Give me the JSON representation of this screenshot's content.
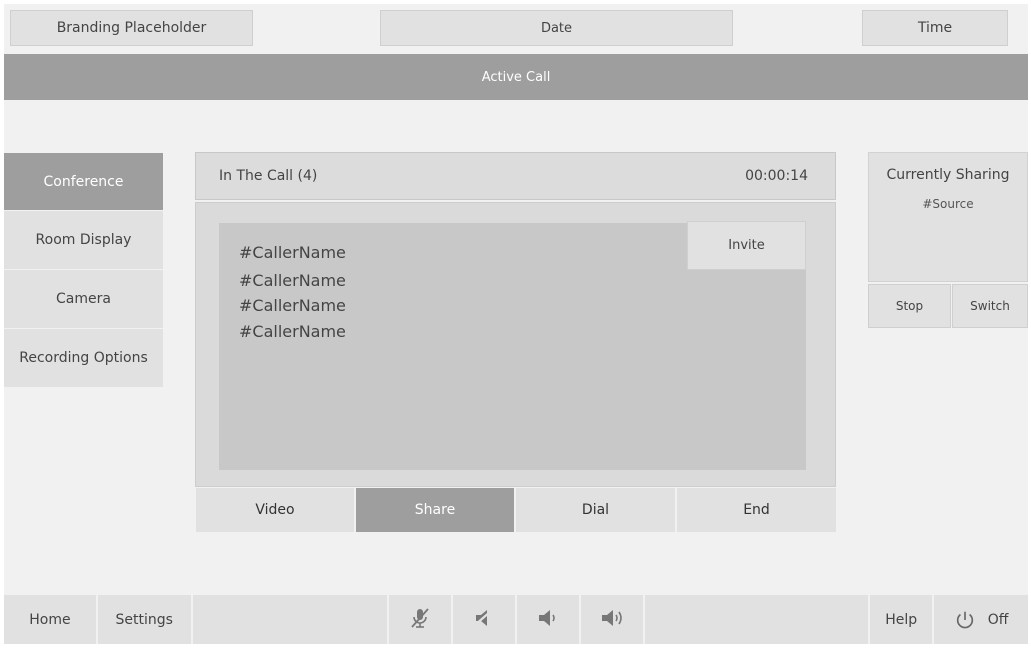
{
  "header": {
    "branding": "Branding Placeholder",
    "date": "Date",
    "time": "Time",
    "title": "Active Call"
  },
  "sidebar": {
    "items": [
      {
        "label": "Conference",
        "active": true
      },
      {
        "label": "Room Display",
        "active": false
      },
      {
        "label": "Camera",
        "active": false
      },
      {
        "label": "Recording Options",
        "active": false
      }
    ]
  },
  "call_panel": {
    "title": "In The Call (4)",
    "timer": "00:00:14",
    "invite_label": "Invite",
    "callers": [
      "#CallerName",
      "#CallerName",
      "#CallerName",
      "#CallerName"
    ]
  },
  "tabs": [
    {
      "label": "Video",
      "active": false
    },
    {
      "label": "Share",
      "active": true
    },
    {
      "label": "Dial",
      "active": false
    },
    {
      "label": "End",
      "active": false
    }
  ],
  "sharing": {
    "title": "Currently Sharing",
    "source": "#Source",
    "stop_label": "Stop",
    "switch_label": "Switch"
  },
  "footer": {
    "home_label": "Home",
    "settings_label": "Settings",
    "help_label": "Help",
    "off_label": "Off",
    "icons": [
      "mic-mute-icon",
      "volume-mute-icon",
      "volume-down-icon",
      "volume-up-icon",
      "power-icon"
    ]
  },
  "colors": {
    "background": "#f1f1f1",
    "panel": "#e1e1e1",
    "active": "#9e9e9e",
    "list_area": "#c8c8c8"
  }
}
